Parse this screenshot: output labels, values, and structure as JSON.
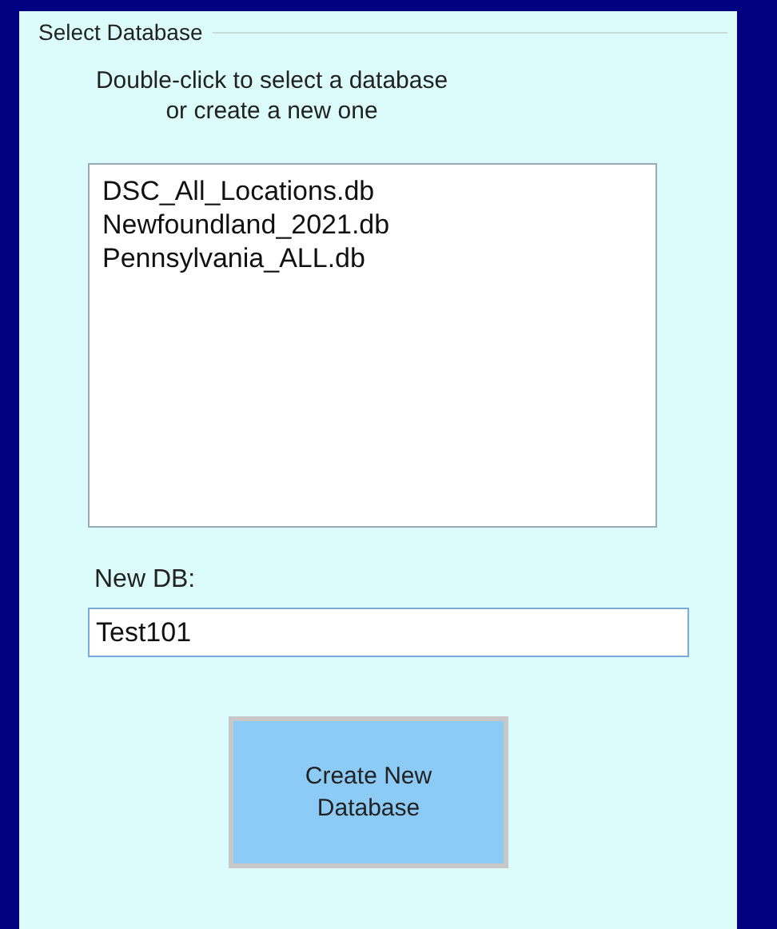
{
  "group": {
    "title": "Select Database"
  },
  "instructions": [
    "Double-click to select a database",
    "or create a new one"
  ],
  "databases": [
    {
      "name": "DSC_All_Locations.db",
      "selected": false
    },
    {
      "name": "Newfoundland_2021.db",
      "selected": false
    },
    {
      "name": "Pennsylvania_ALL.db",
      "selected": false
    }
  ],
  "new_db": {
    "label": "New DB:",
    "value": "Test101"
  },
  "create_button": {
    "label": "Create New Database"
  }
}
